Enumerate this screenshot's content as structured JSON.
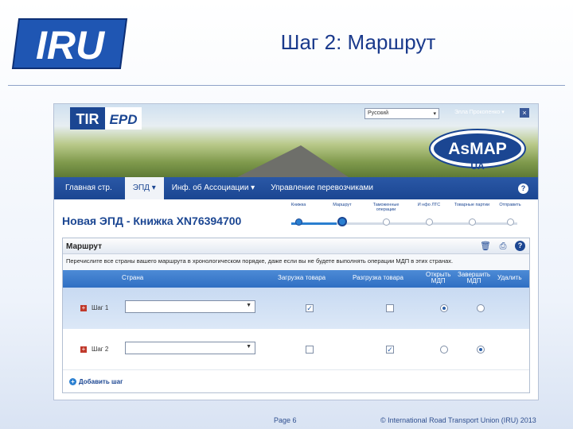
{
  "slide": {
    "logo_text": "IRU",
    "title": "Шаг 2: Маршрут",
    "page_label": "Page 6",
    "copyright": "© International Road Transport Union (IRU) 2013"
  },
  "app": {
    "logo_tir": "TIR",
    "logo_epd": "EPD",
    "language": "Русский",
    "user_name": "Элла Прокопенко",
    "partner_logo_main": "AsMAP",
    "partner_logo_sub": "UA",
    "nav": [
      {
        "label": "Главная стр."
      },
      {
        "label": "ЭПД ▾"
      },
      {
        "label": "Инф. об Ассоциации ▾"
      },
      {
        "label": "Управление перевозчиками"
      }
    ],
    "doc_title": "Новая ЭПД - Книжка XN76394700",
    "wizard_steps": [
      {
        "label": "Книжка",
        "state": "done"
      },
      {
        "label": "Маршрут",
        "state": "current"
      },
      {
        "label": "Таможенные операции",
        "state": "todo"
      },
      {
        "label": "И нфо ЛТС",
        "state": "todo"
      },
      {
        "label": "Товарные партии",
        "state": "todo"
      },
      {
        "label": "Отправить",
        "state": "todo"
      }
    ],
    "panel": {
      "title": "Маршрут",
      "instructions": "Перечислите все страны вашего маршрута в хронологическом порядке, даже если вы не будете выполнять операции МДП в этих странах.",
      "columns": {
        "country": "Страна",
        "loading": "Загрузка товара",
        "unloading": "Разгрузка товара",
        "open_line1": "Открыть",
        "open_line2": "МДП",
        "close_line1": "Завершить",
        "close_line2": "МДП",
        "delete": "Удалить"
      },
      "rows": [
        {
          "step": "Шаг 1",
          "country": "",
          "loading": true,
          "unloading": false,
          "open": true,
          "close": false
        },
        {
          "step": "Шаг 2",
          "country": "",
          "loading": false,
          "unloading": true,
          "open": false,
          "close": true
        }
      ],
      "add_step": "Добавить шаг"
    }
  }
}
